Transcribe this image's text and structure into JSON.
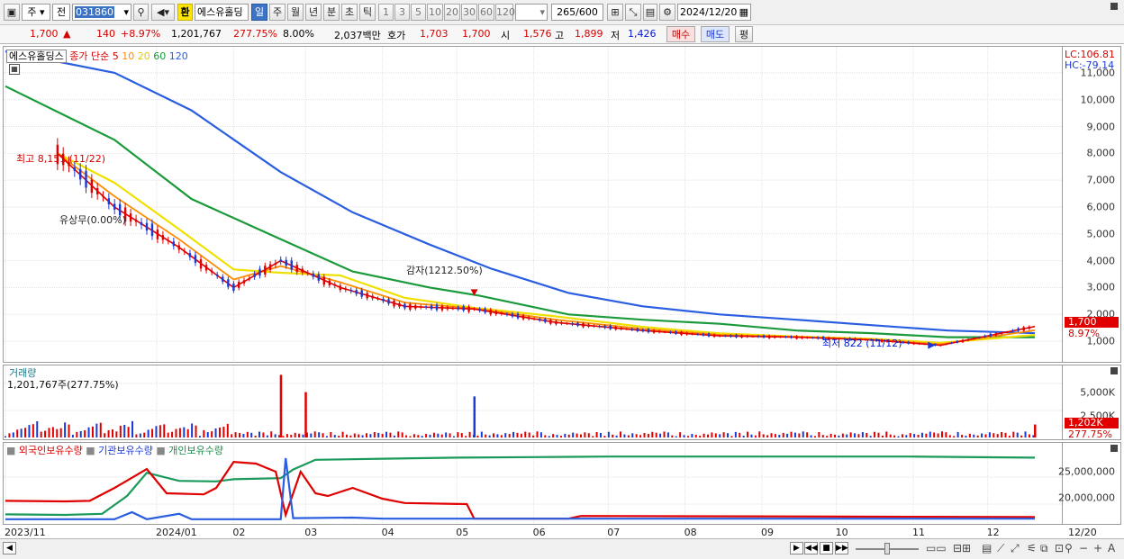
{
  "toolbar": {
    "market": "주",
    "compare": "전",
    "code": "031860",
    "currency_badge": "환",
    "stock_name": "에스유홀딩",
    "periods": [
      "일",
      "주",
      "월",
      "년",
      "분",
      "초",
      "틱"
    ],
    "active_period": "일",
    "intervals": [
      "1",
      "3",
      "5",
      "10",
      "20",
      "30",
      "60",
      "120"
    ],
    "count": "265",
    "count_total": "/600",
    "date": "2024/12/20"
  },
  "quote": {
    "price": "1,700",
    "arrow": "▲",
    "change": "140",
    "change_pct": "+8.97%",
    "volume": "1,201,767",
    "volume_ratio": "277.75%",
    "turnover": "8.00%",
    "amount": "2,037백만",
    "hoga_label": "호가",
    "hoga_sell": "1,703",
    "hoga_buy": "1,700",
    "open_label": "시",
    "open": "1,576",
    "high_label": "고",
    "high": "1,899",
    "low_label": "저",
    "low": "1,426",
    "buy_btn": "매수",
    "sell_btn": "매도",
    "eval_btn": "평"
  },
  "price_panel": {
    "legend_name": "에스유홀딩스",
    "legend_ma": "종가 단순 5",
    "ma_periods": [
      "10",
      "20",
      "60",
      "120"
    ],
    "lc": "LC:106.81",
    "hc": "HC:-79.14",
    "y_labels": [
      "11,000",
      "10,000",
      "9,000",
      "8,000",
      "7,000",
      "6,000",
      "5,000",
      "4,000",
      "3,000",
      "2,000",
      "1,000"
    ],
    "high_annotation": "최고 8,151 (11/22)",
    "low_annotation": "최저 822 (11/12)",
    "event_reduction": "감자(1212.50%)",
    "event_other": "유상무(0.00%)",
    "price_tag": "1,700",
    "pct_tag": "8.97%"
  },
  "volume_panel": {
    "title": "거래량",
    "value": "1,201,767주(277.75%)",
    "y_labels": [
      "5,000K",
      "2,500K"
    ],
    "tag": "1,202K",
    "pct_tag": "277.75%"
  },
  "holder_panel": {
    "legend": [
      "외국인보유수량",
      "기관보유수량",
      "개인보유수량"
    ],
    "y_labels": [
      "25,000,000",
      "20,000,000"
    ]
  },
  "x_axis": {
    "labels": [
      "2023/11",
      "2024/01",
      "02",
      "03",
      "04",
      "05",
      "06",
      "07",
      "08",
      "09",
      "10",
      "11",
      "12"
    ],
    "last_date": "12/20"
  },
  "colors": {
    "ma5": "#e00000",
    "ma10": "#ff8c00",
    "ma20": "#f0e000",
    "ma60": "#1a9a3a",
    "ma120": "#2a5ee0",
    "up": "#e00000",
    "down": "#1a3ad6",
    "foreign": "#e00000",
    "institution": "#2a5ee0",
    "individual": "#1a9a5a"
  },
  "chart_data": [
    {
      "type": "line",
      "title": "",
      "series": [
        {
          "name": "5",
          "x": [
            "2023-11-22",
            "2023-12-15",
            "2024-01-10",
            "2024-02-01",
            "2024-02-20",
            "2024-03-15",
            "2024-04-10",
            "2024-05-08",
            "2024-06-10",
            "2024-07-15",
            "2024-08-15",
            "2024-09-15",
            "2024-10-15",
            "2024-11-12",
            "2024-12-20"
          ],
          "values": [
            8000,
            6000,
            4500,
            3000,
            4000,
            3000,
            2300,
            2200,
            1700,
            1400,
            1200,
            1150,
            1050,
            850,
            1550
          ]
        },
        {
          "name": "60",
          "x": [
            "2023-11-01",
            "2023-12-15",
            "2024-01-15",
            "2024-02-20",
            "2024-03-20",
            "2024-04-20",
            "2024-05-10",
            "2024-06-15",
            "2024-07-15",
            "2024-08-15",
            "2024-09-15",
            "2024-10-15",
            "2024-11-15",
            "2024-12-20"
          ],
          "values": [
            10500,
            8500,
            6300,
            4800,
            3600,
            3000,
            2700,
            2000,
            1800,
            1650,
            1400,
            1300,
            1150,
            1150
          ]
        },
        {
          "name": "120",
          "x": [
            "2023-11-01",
            "2023-12-15",
            "2024-01-15",
            "2024-02-20",
            "2024-03-20",
            "2024-04-20",
            "2024-05-15",
            "2024-06-15",
            "2024-07-15",
            "2024-08-15",
            "2024-09-15",
            "2024-10-15",
            "2024-11-15",
            "2024-12-20"
          ],
          "values": [
            11800,
            11000,
            9600,
            7300,
            5800,
            4600,
            3700,
            2800,
            2300,
            2000,
            1800,
            1600,
            1400,
            1300
          ]
        }
      ],
      "ylim": [
        500,
        11700
      ]
    },
    {
      "type": "bar",
      "title": "거래량",
      "ylim": [
        0,
        6000000
      ],
      "values_K": [
        {
          "x": "2024-02-20",
          "v": 5800
        },
        {
          "x": "2024-03-01",
          "v": 4200
        },
        {
          "x": "2024-05-08",
          "v": 3800
        },
        {
          "x": "2024-12-20",
          "v": 1202
        }
      ]
    },
    {
      "type": "line",
      "series": [
        {
          "name": "외국인보유수량"
        },
        {
          "name": "기관보유수량"
        },
        {
          "name": "개인보유수량"
        }
      ],
      "ylim": [
        17000000,
        30000000
      ]
    }
  ]
}
